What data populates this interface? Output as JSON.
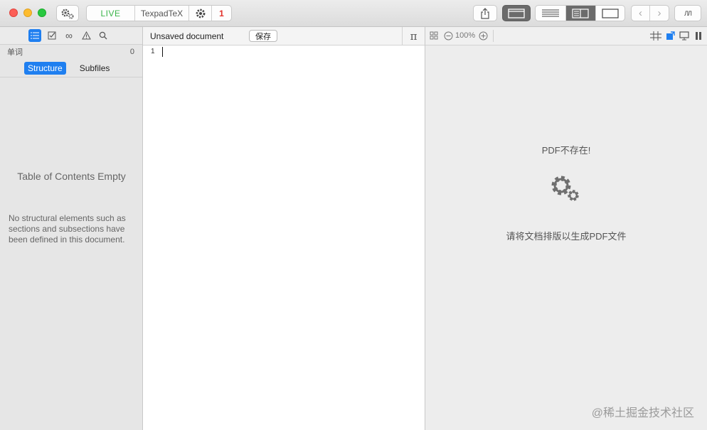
{
  "toolbar": {
    "live_label": "LIVE",
    "typeset_label": "TexpadTeX",
    "error_count": "1",
    "preview_label": "ЛЛ"
  },
  "sidebar": {
    "word_label": "单词",
    "word_count": "0",
    "tabs": [
      {
        "label": "Structure",
        "active": true
      },
      {
        "label": "Subfiles",
        "active": false
      }
    ],
    "toc_title": "Table of Contents Empty",
    "toc_body": "No structural elements such as sections and subsections have been defined in this document."
  },
  "editor": {
    "document_title": "Unsaved document",
    "save_label": "保存",
    "pi_label": "π",
    "line_number": "1"
  },
  "pdf": {
    "zoom": "100%",
    "missing_message": "PDF不存在!",
    "hint": "请将文档排版以生成PDF文件"
  },
  "footer": {
    "watermark": "@稀土掘金技术社区"
  },
  "colors": {
    "accent": "#1f7ff0",
    "live_green": "#3bb54a",
    "error_red": "#e2312b"
  }
}
